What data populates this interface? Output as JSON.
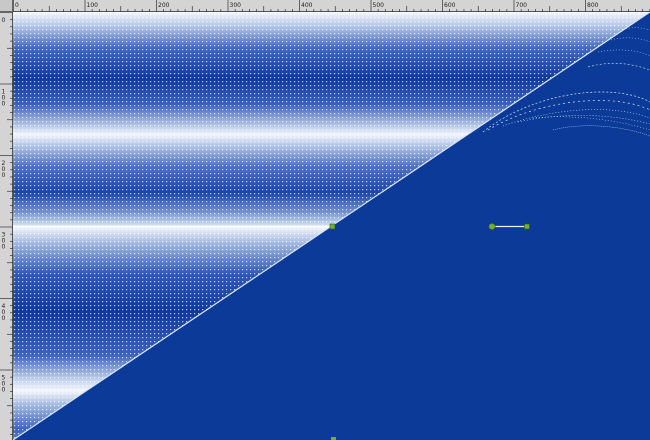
{
  "rulers": {
    "horizontal_labels": [
      "0",
      "100",
      "200",
      "300",
      "400",
      "500",
      "600",
      "700",
      "800"
    ],
    "vertical_labels": [
      "0",
      "100",
      "200",
      "300",
      "400",
      "500"
    ]
  },
  "colors": {
    "canvas_fill": "#0b3a98",
    "pattern_light": "#e8f0fb",
    "pattern_dark": "#0d3a9a",
    "handle_green": "#6fae3a",
    "ruler_bg": "#d4d4d4"
  }
}
